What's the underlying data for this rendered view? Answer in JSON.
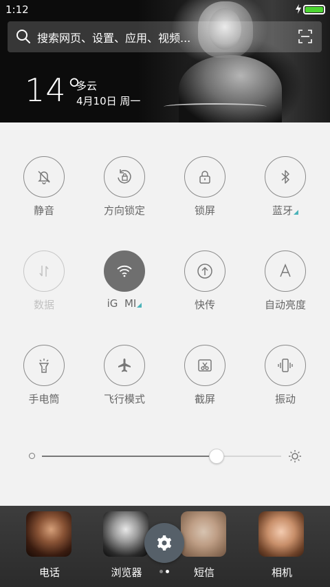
{
  "status_bar": {
    "time": "1:12",
    "battery_color": "#4cd431"
  },
  "search": {
    "placeholder": "搜索网页、设置、应用、视频..."
  },
  "weather": {
    "temperature": "14°",
    "condition": "多云",
    "date": "4月10日 周一"
  },
  "toggles": [
    {
      "label": "静音",
      "icon": "silent-bell-icon",
      "state": "off"
    },
    {
      "label": "方向锁定",
      "icon": "rotation-lock-icon",
      "state": "off"
    },
    {
      "label": "锁屏",
      "icon": "lock-icon",
      "state": "off"
    },
    {
      "label": "蓝牙",
      "icon": "bluetooth-icon",
      "state": "off",
      "expandable": true
    },
    {
      "label": "数据",
      "icon": "mobile-data-icon",
      "state": "disabled"
    },
    {
      "label": "iG  MI",
      "icon": "wifi-icon",
      "state": "on",
      "expandable": true
    },
    {
      "label": "快传",
      "icon": "quick-transfer-icon",
      "state": "off"
    },
    {
      "label": "自动亮度",
      "icon": "auto-brightness-icon",
      "state": "off"
    },
    {
      "label": "手电筒",
      "icon": "flashlight-icon",
      "state": "off"
    },
    {
      "label": "飞行模式",
      "icon": "airplane-icon",
      "state": "off"
    },
    {
      "label": "截屏",
      "icon": "screenshot-icon",
      "state": "off"
    },
    {
      "label": "振动",
      "icon": "vibrate-icon",
      "state": "off"
    }
  ],
  "brightness": {
    "level": 0.73
  },
  "dock": {
    "apps": [
      {
        "label": "电话"
      },
      {
        "label": "浏览器"
      },
      {
        "label": "短信"
      },
      {
        "label": "相机"
      }
    ],
    "page_indicator": {
      "pages": 2,
      "current": 2
    }
  },
  "colors": {
    "accent": "#4bb3b9",
    "active_toggle": "#6f6f6f",
    "fab": "#566069"
  }
}
